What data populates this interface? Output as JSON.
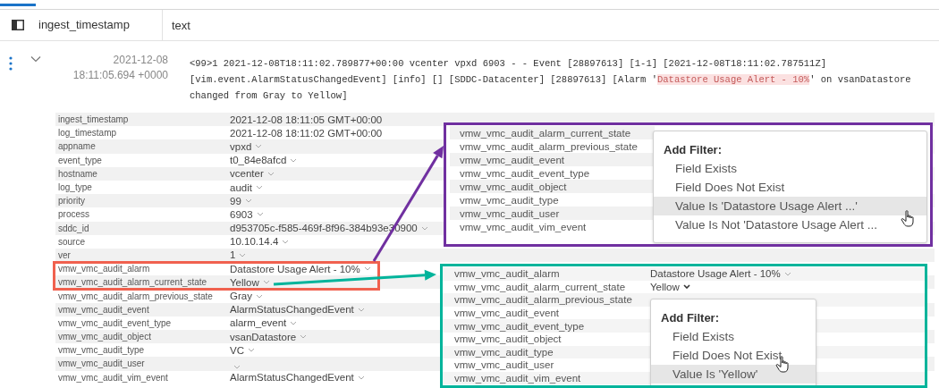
{
  "header": {
    "columns": [
      "ingest_timestamp",
      "text"
    ]
  },
  "event": {
    "expanded": true,
    "date": "2021-12-08",
    "time": "18:11:05.694 +0000",
    "lines": [
      [
        {
          "text": "<99>1 2021-12-08T18:11:02.789877+00:00 vcenter vpxd 6903 - -  Event [28897613] [1-1] [2021-12-08T18:11:02.787511Z]",
          "highlighted": false
        }
      ],
      [
        {
          "text": "[vim.event.AlarmStatusChangedEvent] [info] [] [SDDC-Datacenter] [28897613] [Alarm '",
          "highlighted": false
        },
        {
          "text": "Datastore Usage Alert - 10%",
          "highlighted": true
        },
        {
          "text": "' on vsanDatastore",
          "highlighted": false
        }
      ],
      [
        {
          "text": "changed from Gray to Yellow]",
          "highlighted": false
        }
      ]
    ]
  },
  "fields": [
    {
      "name": "ingest_timestamp",
      "value": "2021-12-08 18:11:05 GMT+00:00",
      "has_menu": false,
      "boxed": false
    },
    {
      "name": "log_timestamp",
      "value": "2021-12-08 18:11:02 GMT+00:00",
      "has_menu": false,
      "boxed": false
    },
    {
      "name": "appname",
      "value": "vpxd",
      "has_menu": true,
      "boxed": false
    },
    {
      "name": "event_type",
      "value": "t0_84e8afcd",
      "has_menu": true,
      "boxed": false
    },
    {
      "name": "hostname",
      "value": "vcenter",
      "has_menu": true,
      "boxed": false
    },
    {
      "name": "log_type",
      "value": "audit",
      "has_menu": true,
      "boxed": false
    },
    {
      "name": "priority",
      "value": "99",
      "has_menu": true,
      "boxed": false
    },
    {
      "name": "process",
      "value": "6903",
      "has_menu": true,
      "boxed": false
    },
    {
      "name": "sddc_id",
      "value": "d953705c-f585-469f-8f96-384b93e30900",
      "has_menu": true,
      "boxed": false
    },
    {
      "name": "source",
      "value": "10.10.14.4",
      "has_menu": true,
      "boxed": false
    },
    {
      "name": "ver",
      "value": "1",
      "has_menu": true,
      "boxed": false
    },
    {
      "name": "vmw_vmc_audit_alarm",
      "value": "Datastore Usage Alert - 10%",
      "has_menu": true,
      "boxed": true
    },
    {
      "name": "vmw_vmc_audit_alarm_current_state",
      "value": "Yellow",
      "has_menu": true,
      "boxed": true
    },
    {
      "name": "vmw_vmc_audit_alarm_previous_state",
      "value": "Gray",
      "has_menu": true,
      "boxed": false
    },
    {
      "name": "vmw_vmc_audit_event",
      "value": "AlarmStatusChangedEvent",
      "has_menu": true,
      "boxed": false
    },
    {
      "name": "vmw_vmc_audit_event_type",
      "value": "alarm_event",
      "has_menu": true,
      "boxed": false
    },
    {
      "name": "vmw_vmc_audit_object",
      "value": "vsanDatastore",
      "has_menu": true,
      "boxed": false
    },
    {
      "name": "vmw_vmc_audit_type",
      "value": "VC",
      "has_menu": true,
      "boxed": false
    },
    {
      "name": "vmw_vmc_audit_user",
      "has_menu": true,
      "boxed": false
    },
    {
      "name": "vmw_vmc_audit_vim_event",
      "value": "AlarmStatusChangedEvent",
      "has_menu": true,
      "boxed": false
    }
  ],
  "callouts": [
    {
      "kind": "purple",
      "color": "#7030a0",
      "rows": [
        {
          "name": "vmw_vmc_audit_alarm_current_state"
        },
        {
          "name": "vmw_vmc_audit_alarm_previous_state"
        },
        {
          "name": "vmw_vmc_audit_event"
        },
        {
          "name": "vmw_vmc_audit_event_type"
        },
        {
          "name": "vmw_vmc_audit_object"
        },
        {
          "name": "vmw_vmc_audit_type"
        },
        {
          "name": "vmw_vmc_audit_user"
        },
        {
          "name": "vmw_vmc_audit_vim_event"
        }
      ],
      "menu": {
        "title": "Add Filter:",
        "items": [
          {
            "label": "Field Exists",
            "selected": false
          },
          {
            "label": "Field Does Not Exist",
            "selected": false
          },
          {
            "label": "Value Is 'Datastore Usage Alert ...'",
            "selected": true
          },
          {
            "label": "Value Is Not 'Datastore Usage Alert ...",
            "selected": false
          }
        ]
      }
    },
    {
      "kind": "teal",
      "color": "#00b49b",
      "rows": [
        {
          "name": "vmw_vmc_audit_alarm",
          "value": "Datastore Usage Alert - 10%",
          "menu_open": false
        },
        {
          "name": "vmw_vmc_audit_alarm_current_state",
          "value": "Yellow",
          "menu_open": true
        },
        {
          "name": "vmw_vmc_audit_alarm_previous_state"
        },
        {
          "name": "vmw_vmc_audit_event"
        },
        {
          "name": "vmw_vmc_audit_event_type"
        },
        {
          "name": "vmw_vmc_audit_object"
        },
        {
          "name": "vmw_vmc_audit_type"
        },
        {
          "name": "vmw_vmc_audit_user"
        },
        {
          "name": "vmw_vmc_audit_vim_event"
        }
      ],
      "menu": {
        "title": "Add Filter:",
        "items": [
          {
            "label": "Field Exists",
            "selected": false
          },
          {
            "label": "Field Does Not Exist",
            "selected": false
          },
          {
            "label": "Value Is 'Yellow'",
            "selected": true
          }
        ]
      }
    }
  ]
}
